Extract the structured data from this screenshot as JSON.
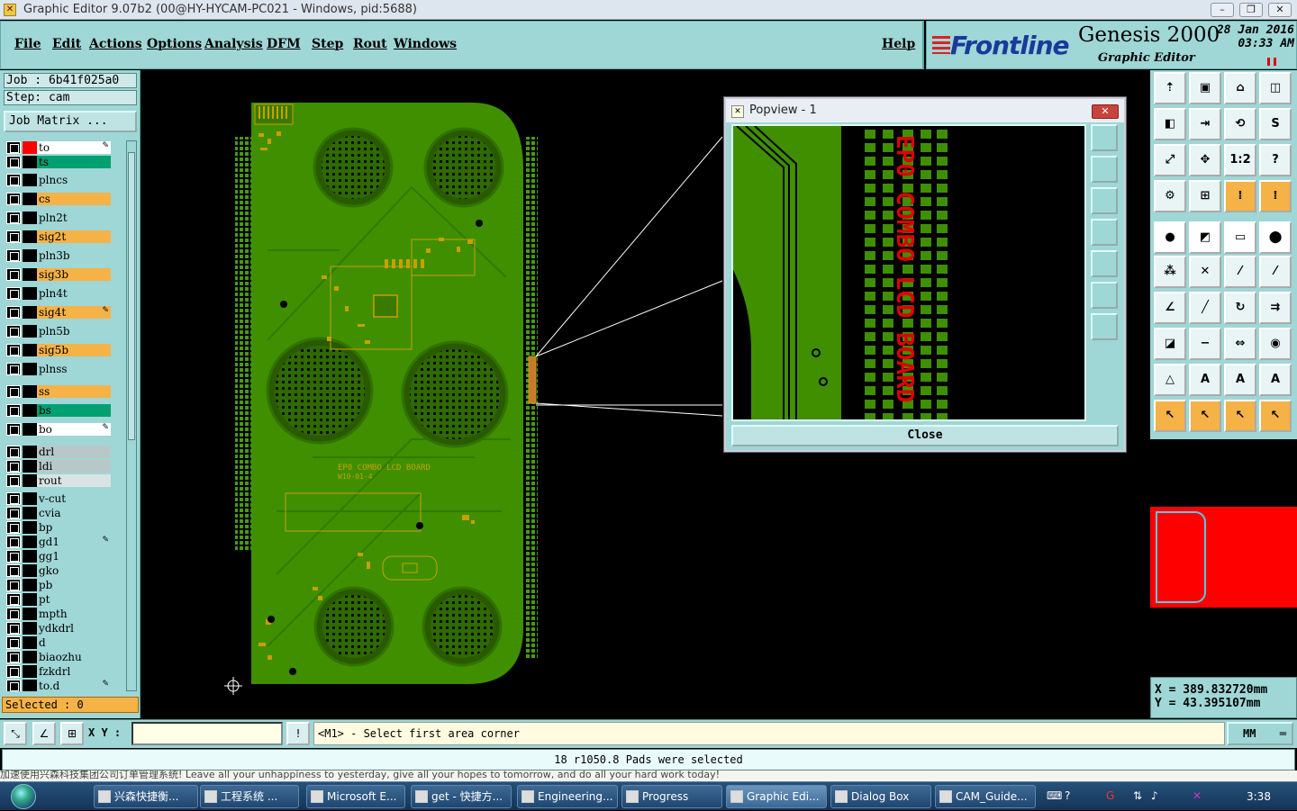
{
  "window": {
    "title": "Graphic Editor 9.07b2 (00@HY-HYCAM-PC021 - Windows, pid:5688)",
    "minimize_label": "–",
    "restore_label": "❐",
    "close_label": "✕"
  },
  "menu": {
    "items": [
      "File",
      "Edit",
      "Actions",
      "Options",
      "Analysis",
      "DFM",
      "Step",
      "Rout",
      "Windows"
    ],
    "help": "Help"
  },
  "brand": {
    "logo": "Frontline",
    "product": "Genesis 2000",
    "subtitle": "Graphic Editor",
    "date": "28 Jan 2016",
    "time": "03:33 AM"
  },
  "job": {
    "job_label": "Job  :  6b41f025a0",
    "step_label": "Step:  cam",
    "job_matrix": "Job Matrix ..."
  },
  "layers": [
    {
      "name": "to",
      "color": "#ffffff",
      "swatch": "#ff0000",
      "editable": true
    },
    {
      "name": "ts",
      "color": "#00a070",
      "swatch": "#000000",
      "editable": false
    },
    {
      "name": "plncs",
      "color": "#9fd6d6",
      "swatch": "#000000",
      "editable": false
    },
    {
      "name": "cs",
      "color": "#f5b247",
      "swatch": "#000000",
      "editable": false
    },
    {
      "name": "pln2t",
      "color": "#9fd6d6",
      "swatch": "#000000",
      "editable": false
    },
    {
      "name": "sig2t",
      "color": "#f5b247",
      "swatch": "#000000",
      "editable": false
    },
    {
      "name": "pln3b",
      "color": "#9fd6d6",
      "swatch": "#000000",
      "editable": false
    },
    {
      "name": "sig3b",
      "color": "#f5b247",
      "swatch": "#000000",
      "editable": false
    },
    {
      "name": "pln4t",
      "color": "#9fd6d6",
      "swatch": "#000000",
      "editable": false
    },
    {
      "name": "sig4t",
      "color": "#f5b247",
      "swatch": "#000000",
      "editable": true
    },
    {
      "name": "pln5b",
      "color": "#9fd6d6",
      "swatch": "#000000",
      "editable": false
    },
    {
      "name": "sig5b",
      "color": "#f5b247",
      "swatch": "#000000",
      "editable": false
    },
    {
      "name": "plnss",
      "color": "#9fd6d6",
      "swatch": "#000000",
      "editable": false
    },
    {
      "name": "ss",
      "color": "#f5b247",
      "swatch": "#000000",
      "editable": false
    },
    {
      "name": "bs",
      "color": "#00a070",
      "swatch": "#000000",
      "editable": false
    },
    {
      "name": "bo",
      "color": "#ffffff",
      "swatch": "#000000",
      "editable": true
    },
    {
      "name": "drl",
      "color": "#b8c8c8",
      "swatch": "#000000",
      "editable": false
    },
    {
      "name": "ldi",
      "color": "#b8c8c8",
      "swatch": "#000000",
      "editable": false
    },
    {
      "name": "rout",
      "color": "#d8e4e4",
      "swatch": "#000000",
      "editable": false
    },
    {
      "name": "v-cut",
      "color": "#9fd6d6",
      "swatch": "#000000",
      "editable": false
    },
    {
      "name": "cvia",
      "color": "#9fd6d6",
      "swatch": "#000000",
      "editable": false
    },
    {
      "name": "bp",
      "color": "#9fd6d6",
      "swatch": "#000000",
      "editable": false
    },
    {
      "name": "gd1",
      "color": "#9fd6d6",
      "swatch": "#000000",
      "editable": true
    },
    {
      "name": "gg1",
      "color": "#9fd6d6",
      "swatch": "#000000",
      "editable": false
    },
    {
      "name": "gko",
      "color": "#9fd6d6",
      "swatch": "#000000",
      "editable": false
    },
    {
      "name": "pb",
      "color": "#9fd6d6",
      "swatch": "#000000",
      "editable": false
    },
    {
      "name": "pt",
      "color": "#9fd6d6",
      "swatch": "#000000",
      "editable": false
    },
    {
      "name": "mpth",
      "color": "#9fd6d6",
      "swatch": "#000000",
      "editable": false
    },
    {
      "name": "ydkdrl",
      "color": "#9fd6d6",
      "swatch": "#000000",
      "editable": false
    },
    {
      "name": "d",
      "color": "#9fd6d6",
      "swatch": "#000000",
      "editable": false
    },
    {
      "name": "biaozhu",
      "color": "#9fd6d6",
      "swatch": "#000000",
      "editable": false
    },
    {
      "name": "fzkdrl",
      "color": "#9fd6d6",
      "swatch": "#000000",
      "editable": false
    },
    {
      "name": "to.d",
      "color": "#9fd6d6",
      "swatch": "#000000",
      "editable": true
    }
  ],
  "selected_label": "Selected : 0",
  "board": {
    "silk_text_1": "EP0 COMBO LCD BOARD",
    "silk_text_2": "W10-01-4",
    "colors": {
      "board": "#3f8f00",
      "copper": "#c8a000",
      "pad": "#2e6a00"
    }
  },
  "popview": {
    "title": "Popview - 1",
    "close_label": "Close",
    "text": "EP0 COMBO LCD BOARD"
  },
  "coords": {
    "x": "X  =  389.832720mm",
    "y": "Y  =  43.395107mm"
  },
  "bottom": {
    "xy_label": "X Y :",
    "xy_value": "",
    "prompt": "<M1> - Select first area corner",
    "units": "MM"
  },
  "status": "18 r1050.8 Pads were selected",
  "ticker": "加速使用兴森科技集团公司订单管理系统!          Leave all your unhappiness to yesterday, give all your hopes to tomorrow, and do all your hard work today!",
  "taskbar": {
    "tasks": [
      "兴森快捷衡...",
      "工程系统    ...",
      "Microsoft E...",
      "get - 快捷方...",
      "Engineering...",
      "Progress",
      "Graphic Edi...",
      "Dialog Box",
      "CAM_Guide..."
    ],
    "clock": "3:38"
  }
}
